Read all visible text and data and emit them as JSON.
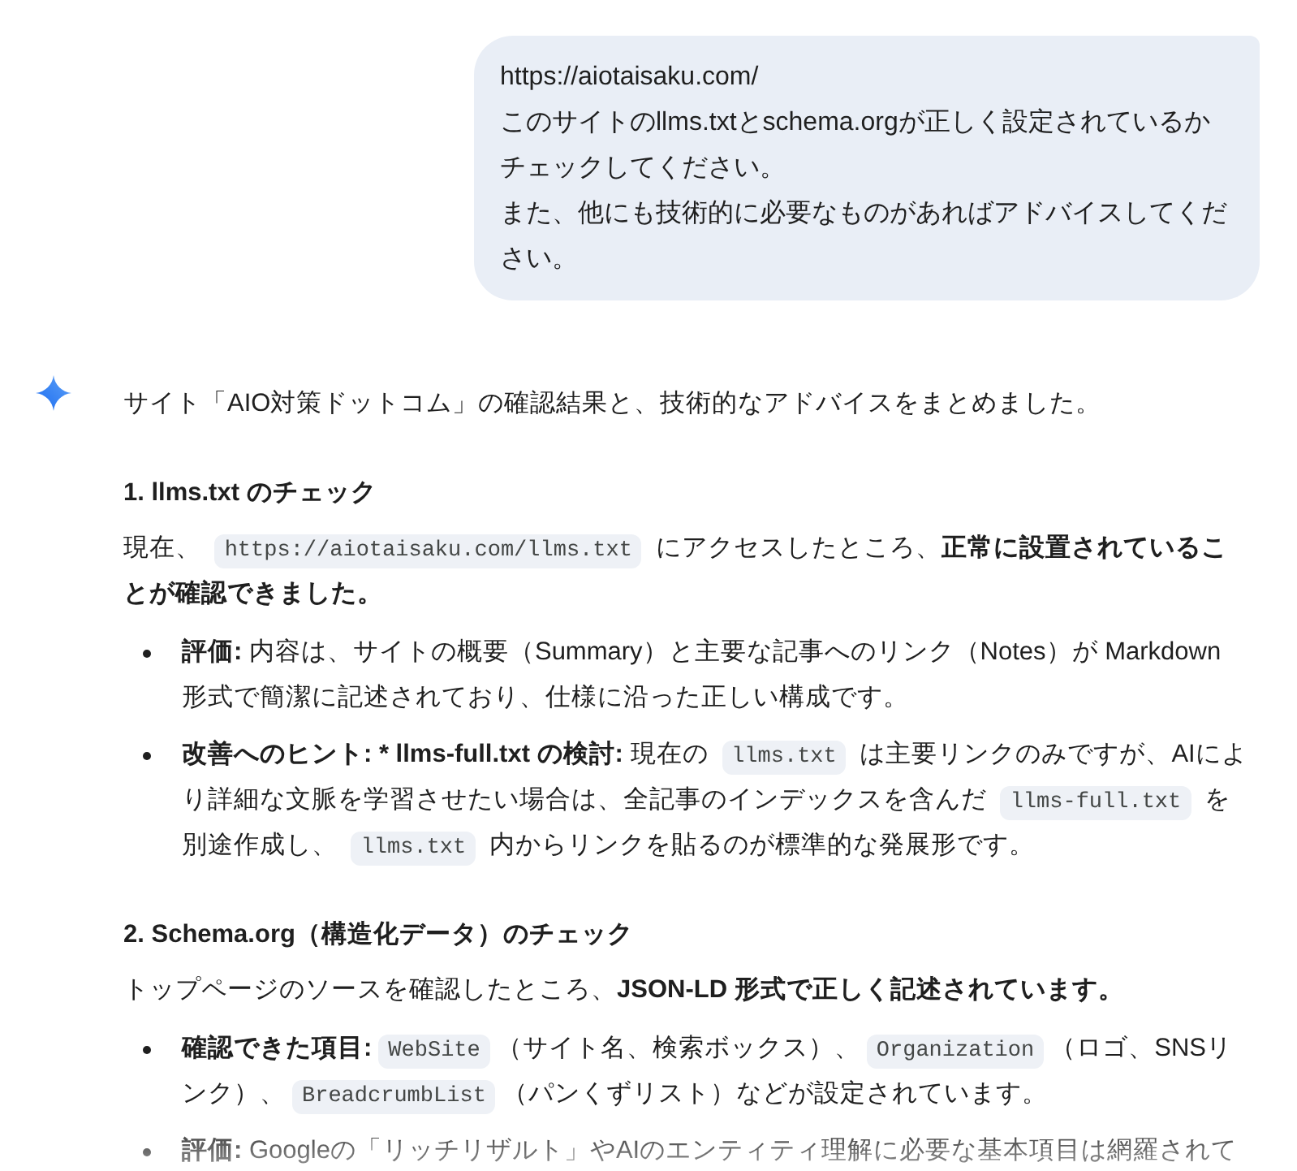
{
  "user_message": {
    "lines": [
      "https://aiotaisaku.com/",
      "このサイトのllms.txtとschema.orgが正しく設定されているかチェックしてください。",
      "また、他にも技術的に必要なものがあればアドバイスしてください。"
    ]
  },
  "response": {
    "intro": "サイト「AIO対策ドットコム」の確認結果と、技術的なアドバイスをまとめました。",
    "sections": [
      {
        "heading": "1. llms.txt のチェック",
        "paragraph": [
          {
            "kind": "text",
            "text": "現在、 "
          },
          {
            "kind": "code",
            "text": "https://aiotaisaku.com/llms.txt"
          },
          {
            "kind": "text",
            "text": " にアクセスしたところ、"
          },
          {
            "kind": "bold",
            "text": "正常に設置されていることが確認できました。"
          }
        ],
        "bullets": [
          {
            "segments": [
              {
                "kind": "bold",
                "text": "評価:"
              },
              {
                "kind": "text",
                "text": " 内容は、サイトの概要（Summary）と主要な記事へのリンク（Notes）が Markdown 形式で簡潔に記述されており、仕様に沿った正しい構成です。"
              }
            ]
          },
          {
            "segments": [
              {
                "kind": "bold",
                "text": "改善へのヒント: * llms-full.txt の検討:"
              },
              {
                "kind": "text",
                "text": " 現在の "
              },
              {
                "kind": "code",
                "text": "llms.txt"
              },
              {
                "kind": "text",
                "text": " は主要リンクのみですが、AIにより詳細な文脈を学習させたい場合は、全記事のインデックスを含んだ "
              },
              {
                "kind": "code",
                "text": "llms-full.txt"
              },
              {
                "kind": "text",
                "text": " を別途作成し、 "
              },
              {
                "kind": "code",
                "text": "llms.txt"
              },
              {
                "kind": "text",
                "text": " 内からリンクを貼るのが標準的な発展形です。"
              }
            ]
          }
        ]
      },
      {
        "heading": "2. Schema.org（構造化データ）のチェック",
        "paragraph": [
          {
            "kind": "text",
            "text": "トップページのソースを確認したところ、"
          },
          {
            "kind": "bold",
            "text": "JSON-LD 形式で正しく記述されています。"
          }
        ],
        "bullets": [
          {
            "segments": [
              {
                "kind": "bold",
                "text": "確認できた項目:"
              },
              {
                "kind": "code",
                "text": "WebSite"
              },
              {
                "kind": "text",
                "text": "（サイト名、検索ボックス）、"
              },
              {
                "kind": "code",
                "text": "Organization"
              },
              {
                "kind": "text",
                "text": "（ロゴ、SNSリンク）、"
              },
              {
                "kind": "code",
                "text": "BreadcrumbList"
              },
              {
                "kind": "text",
                "text": "（パンくずリスト）などが設定されています。"
              }
            ]
          },
          {
            "segments": [
              {
                "kind": "bold",
                "text": "評価:"
              },
              {
                "kind": "text",
                "text": " Googleの「リッチリザルト」やAIのエンティティ理解に必要な基本項目は網羅されて"
              }
            ]
          }
        ]
      }
    ]
  }
}
